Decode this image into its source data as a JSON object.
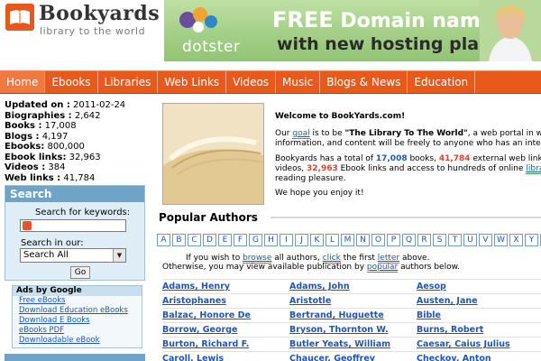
{
  "header": {
    "logo_name": "Bookyards",
    "logo_tagline": "library to the world",
    "banner": {
      "brand": "dotster",
      "line1_strong": "FREE",
      "line1_rest": "Domain name",
      "line2": "with new hosting plans"
    }
  },
  "nav": {
    "items": [
      {
        "label": "Home",
        "active": true
      },
      {
        "label": "Ebooks"
      },
      {
        "label": "Libraries"
      },
      {
        "label": "Web Links"
      },
      {
        "label": "Videos"
      },
      {
        "label": "Music"
      },
      {
        "label": "Blogs & News"
      },
      {
        "label": "Education"
      }
    ]
  },
  "stats": {
    "updated": {
      "label": "Updated on :",
      "value": "2011-02-24"
    },
    "biographies": {
      "label": "Biographies :",
      "value": "2,642"
    },
    "books": {
      "label": "Books :",
      "value": "17,008"
    },
    "blogs": {
      "label": "Blogs :",
      "value": "4,197"
    },
    "ebooks": {
      "label": "Ebooks:",
      "value": "800,000"
    },
    "ebook_links": {
      "label": "Ebook links:",
      "value": "32,963"
    },
    "videos": {
      "label": "Videos :",
      "value": "384"
    },
    "web_links": {
      "label": "Web links :",
      "value": "41,784"
    }
  },
  "search": {
    "title": "Search",
    "keywords_label": "Search for keywords:",
    "keywords_value": "",
    "in_label": "Search in our:",
    "select_value": "Search All",
    "go_label": "Go"
  },
  "ads": {
    "title": "Ads by Google",
    "links": [
      "Free eBooks",
      "Download Education eBooks",
      "Download E Books",
      "eBooks PDF",
      "Downloadable eBook"
    ]
  },
  "left_bottom_label": "",
  "welcome": {
    "title": "Welcome to BookYards.com!",
    "p1_a": "Our ",
    "p1_goal": "goal",
    "p1_b": " is to be ",
    "p1_quote": "\"The Library To The World\"",
    "p1_c": ", a web portal in whic",
    "p1_line2": "information, and content will be freely to anyone who has an internet",
    "p2_a": "Bookyards has a total of ",
    "p2_books": "17,008",
    "p2_b": " books, ",
    "p2_links": "41,784",
    "p2_c": " external web links, 4",
    "p2_line2_a": "videos, ",
    "p2_ebooklinks": "32,963",
    "p2_line2_b": " Ebook links and access to hundreds of online ",
    "p2_libraries": "libraries",
    "p2_line3": "reading pleasure.",
    "p3": "We hope you enjoy it!"
  },
  "popular": {
    "title": "Popular Authors",
    "letters": [
      "A",
      "B",
      "C",
      "D",
      "E",
      "F",
      "G",
      "H",
      "I",
      "J",
      "K",
      "L",
      "M",
      "N",
      "O",
      "P",
      "Q",
      "R",
      "S",
      "T",
      "U",
      "V",
      "W",
      "X",
      "Y",
      "Z"
    ],
    "instr1_a": "If you wish to ",
    "instr1_browse": "browse",
    "instr1_b": " all authors, ",
    "instr1_click": "click",
    "instr1_c": " the first ",
    "instr1_letter": "letter",
    "instr1_d": " above.",
    "instr2_a": "Otherwise, you may view available publication by ",
    "instr2_popular": "popular",
    "instr2_b": " authors below.",
    "rows": [
      [
        "Adams, Henry",
        "Adams, John",
        "Aesop"
      ],
      [
        "Aristophanes",
        "Aristotle",
        "Austen, Jane"
      ],
      [
        "Balzac, Honore De",
        "Bertrand, Huguette",
        "Bible"
      ],
      [
        "Borrow, George",
        "Bryson, Thornton W.",
        "Burns, Robert"
      ],
      [
        "Burton, Richard F.",
        "Butler Yeats, William",
        "Caesar, Caius Julius"
      ],
      [
        "Caroll, Lewis",
        "Chaucer, Geoffrey",
        "Checkov, Anton"
      ]
    ]
  },
  "colors": {
    "nav_bg": "#e85a1b",
    "search_header": "#6fa3c8",
    "link": "#1f56b4",
    "count_red": "#d9442e"
  }
}
